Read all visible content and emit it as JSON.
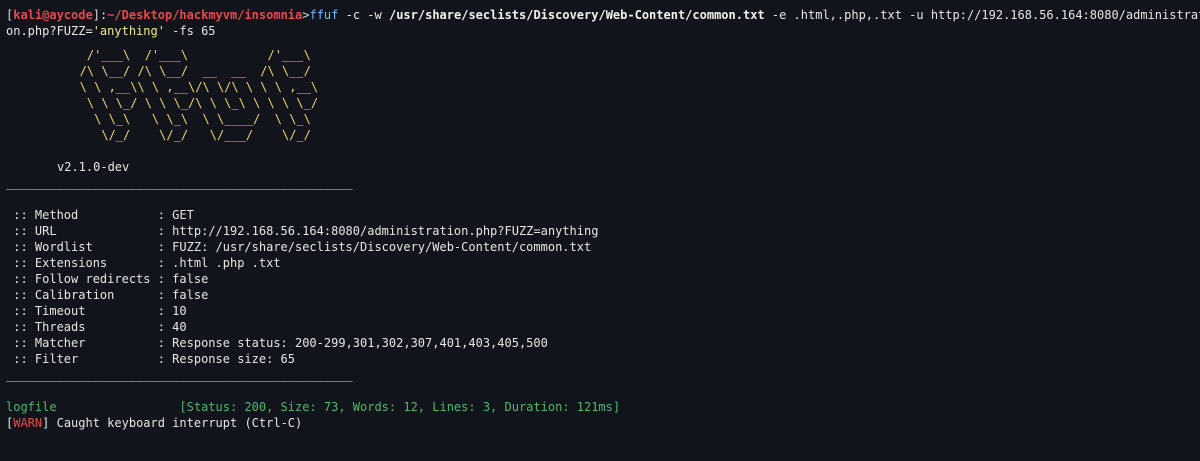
{
  "prompt": {
    "open": "[",
    "user_host": "kali@aycode",
    "sep": "]:",
    "path": "~/Desktop/hackmyvm/insomnia",
    "arrow": ">"
  },
  "command": {
    "tool": "ffuf",
    "part1": " -c -w ",
    "wordlist": "/usr/share/seclists/Discovery/Web-Content/common.txt",
    "part2": " -e .html,.php,.txt -u http://192.168.56.164:8080/administrati",
    "part3": "on.php?FUZZ=",
    "string": "'anything'",
    "part4": " -fs 65"
  },
  "banner": {
    "art": "    /'___\\  /'___\\           /'___\\\n   /\\ \\__/ /\\ \\__/  __  __  /\\ \\__/\n   \\ \\ ,__\\\\ \\ ,__\\/\\ \\/\\ \\ \\ \\ ,__\\\n    \\ \\ \\_/ \\ \\ \\_/\\ \\ \\_\\ \\ \\ \\ \\_/\n     \\ \\_\\   \\ \\_\\  \\ \\____/  \\ \\_\\\n      \\/_/    \\/_/   \\/___/    \\/_/",
    "version": "v2.1.0-dev"
  },
  "separator": "________________________________________________",
  "config": [
    {
      "key": " :: Method           ",
      "value": ": GET"
    },
    {
      "key": " :: URL              ",
      "value": ": http://192.168.56.164:8080/administration.php?FUZZ=anything"
    },
    {
      "key": " :: Wordlist         ",
      "value": ": FUZZ: /usr/share/seclists/Discovery/Web-Content/common.txt"
    },
    {
      "key": " :: Extensions       ",
      "value": ": .html .php .txt"
    },
    {
      "key": " :: Follow redirects ",
      "value": ": false"
    },
    {
      "key": " :: Calibration      ",
      "value": ": false"
    },
    {
      "key": " :: Timeout          ",
      "value": ": 10"
    },
    {
      "key": " :: Threads          ",
      "value": ": 40"
    },
    {
      "key": " :: Matcher          ",
      "value": ": Response status: 200-299,301,302,307,401,403,405,500"
    },
    {
      "key": " :: Filter           ",
      "value": ": Response size: 65"
    }
  ],
  "result": {
    "name": "logfile                 ",
    "detail": "[Status: 200, Size: 73, Words: 12, Lines: 3, Duration: 121ms]"
  },
  "warning": {
    "open": "[",
    "tag": "WARN",
    "close": "]",
    "message": " Caught keyboard interrupt (Ctrl-C)"
  }
}
